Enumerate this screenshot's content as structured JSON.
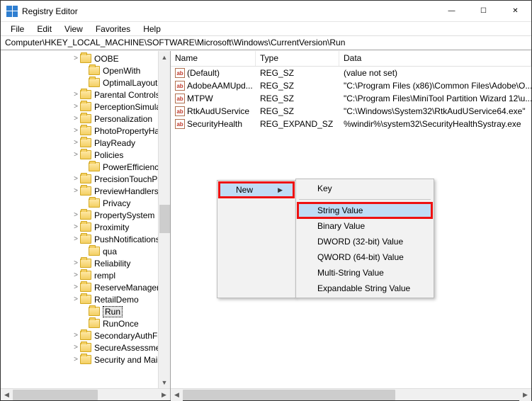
{
  "window": {
    "title": "Registry Editor",
    "min": "—",
    "max": "☐",
    "close": "✕"
  },
  "menu": {
    "file": "File",
    "edit": "Edit",
    "view": "View",
    "favorites": "Favorites",
    "help": "Help"
  },
  "address": "Computer\\HKEY_LOCAL_MACHINE\\SOFTWARE\\Microsoft\\Windows\\CurrentVersion\\Run",
  "tree": [
    {
      "indent": 100,
      "exp": ">",
      "label": "OOBE"
    },
    {
      "indent": 112,
      "exp": "",
      "label": "OpenWith"
    },
    {
      "indent": 112,
      "exp": "",
      "label": "OptimalLayout"
    },
    {
      "indent": 100,
      "exp": ">",
      "label": "Parental Controls"
    },
    {
      "indent": 100,
      "exp": ">",
      "label": "PerceptionSimulation"
    },
    {
      "indent": 100,
      "exp": ">",
      "label": "Personalization"
    },
    {
      "indent": 100,
      "exp": ">",
      "label": "PhotoPropertyHandler"
    },
    {
      "indent": 100,
      "exp": ">",
      "label": "PlayReady"
    },
    {
      "indent": 100,
      "exp": ">",
      "label": "Policies"
    },
    {
      "indent": 112,
      "exp": "",
      "label": "PowerEfficiencyDiagnostics"
    },
    {
      "indent": 100,
      "exp": ">",
      "label": "PrecisionTouchPad"
    },
    {
      "indent": 100,
      "exp": ">",
      "label": "PreviewHandlers"
    },
    {
      "indent": 112,
      "exp": "",
      "label": "Privacy"
    },
    {
      "indent": 100,
      "exp": ">",
      "label": "PropertySystem"
    },
    {
      "indent": 100,
      "exp": ">",
      "label": "Proximity"
    },
    {
      "indent": 100,
      "exp": ">",
      "label": "PushNotifications"
    },
    {
      "indent": 112,
      "exp": "",
      "label": "qua"
    },
    {
      "indent": 100,
      "exp": ">",
      "label": "Reliability"
    },
    {
      "indent": 100,
      "exp": ">",
      "label": "rempl"
    },
    {
      "indent": 100,
      "exp": ">",
      "label": "ReserveManager"
    },
    {
      "indent": 100,
      "exp": ">",
      "label": "RetailDemo"
    },
    {
      "indent": 112,
      "exp": "",
      "label": "Run",
      "selected": true
    },
    {
      "indent": 112,
      "exp": "",
      "label": "RunOnce"
    },
    {
      "indent": 100,
      "exp": ">",
      "label": "SecondaryAuthFactor"
    },
    {
      "indent": 100,
      "exp": ">",
      "label": "SecureAssessment"
    },
    {
      "indent": 100,
      "exp": ">",
      "label": "Security and Maintenance"
    }
  ],
  "cols": {
    "name": "Name",
    "type": "Type",
    "data": "Data"
  },
  "rows": [
    {
      "name": "(Default)",
      "type": "REG_SZ",
      "data": "(value not set)"
    },
    {
      "name": "AdobeAAMUpd...",
      "type": "REG_SZ",
      "data": "\"C:\\Program Files (x86)\\Common Files\\Adobe\\O..."
    },
    {
      "name": "MTPW",
      "type": "REG_SZ",
      "data": "\"C:\\Program Files\\MiniTool Partition Wizard 12\\u..."
    },
    {
      "name": "RtkAudUService",
      "type": "REG_SZ",
      "data": "\"C:\\Windows\\System32\\RtkAudUService64.exe\""
    },
    {
      "name": "SecurityHealth",
      "type": "REG_EXPAND_SZ",
      "data": "%windir%\\system32\\SecurityHealthSystray.exe"
    }
  ],
  "ctx": {
    "new": "New",
    "sub": {
      "key": "Key",
      "string": "String Value",
      "binary": "Binary Value",
      "dword": "DWORD (32-bit) Value",
      "qword": "QWORD (64-bit) Value",
      "multi": "Multi-String Value",
      "expand": "Expandable String Value"
    }
  },
  "regicon": "ab"
}
